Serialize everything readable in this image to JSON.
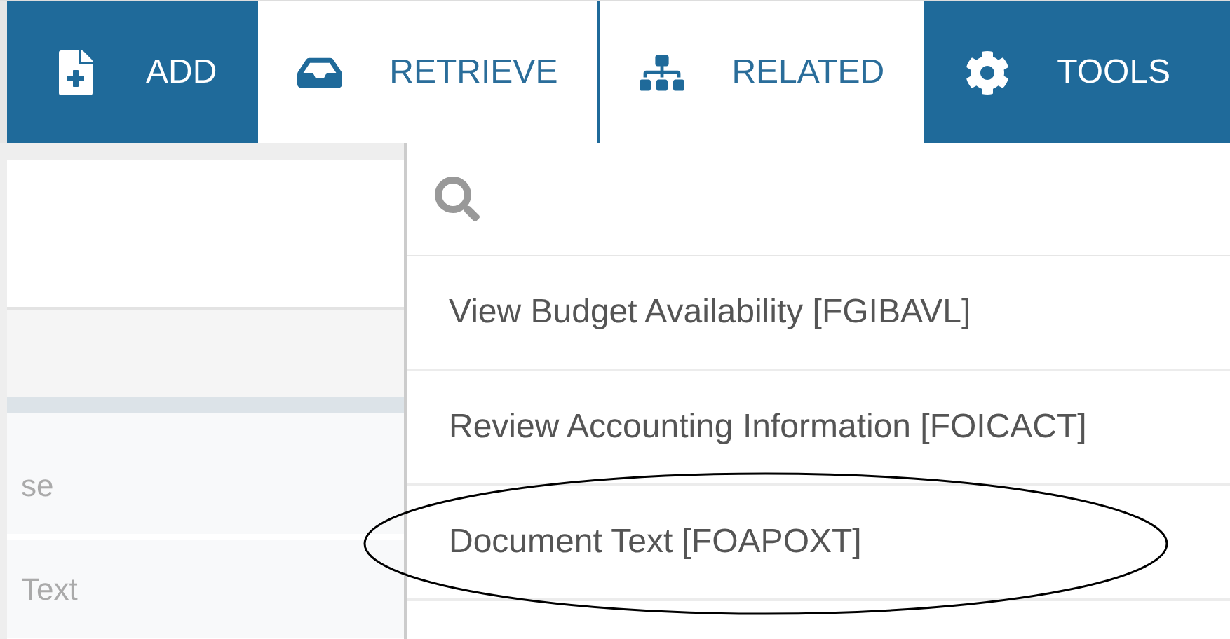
{
  "toolbar": {
    "buttons": [
      {
        "label": "ADD",
        "kind": "add",
        "selected": false
      },
      {
        "label": "RETRIEVE",
        "kind": "retrieve",
        "selected": true
      },
      {
        "label": "RELATED",
        "kind": "related",
        "selected": true
      },
      {
        "label": "TOOLS",
        "kind": "tools",
        "selected": false
      }
    ]
  },
  "left_panel": {
    "rows": [
      "se",
      "Text"
    ]
  },
  "related_menu": {
    "items": [
      {
        "label": "View Budget Availability [FGIBAVL]",
        "circled": false
      },
      {
        "label": "Review Accounting Information [FOICACT]",
        "circled": false
      },
      {
        "label": "Document Text [FOAPOXT]",
        "circled": true
      }
    ]
  }
}
